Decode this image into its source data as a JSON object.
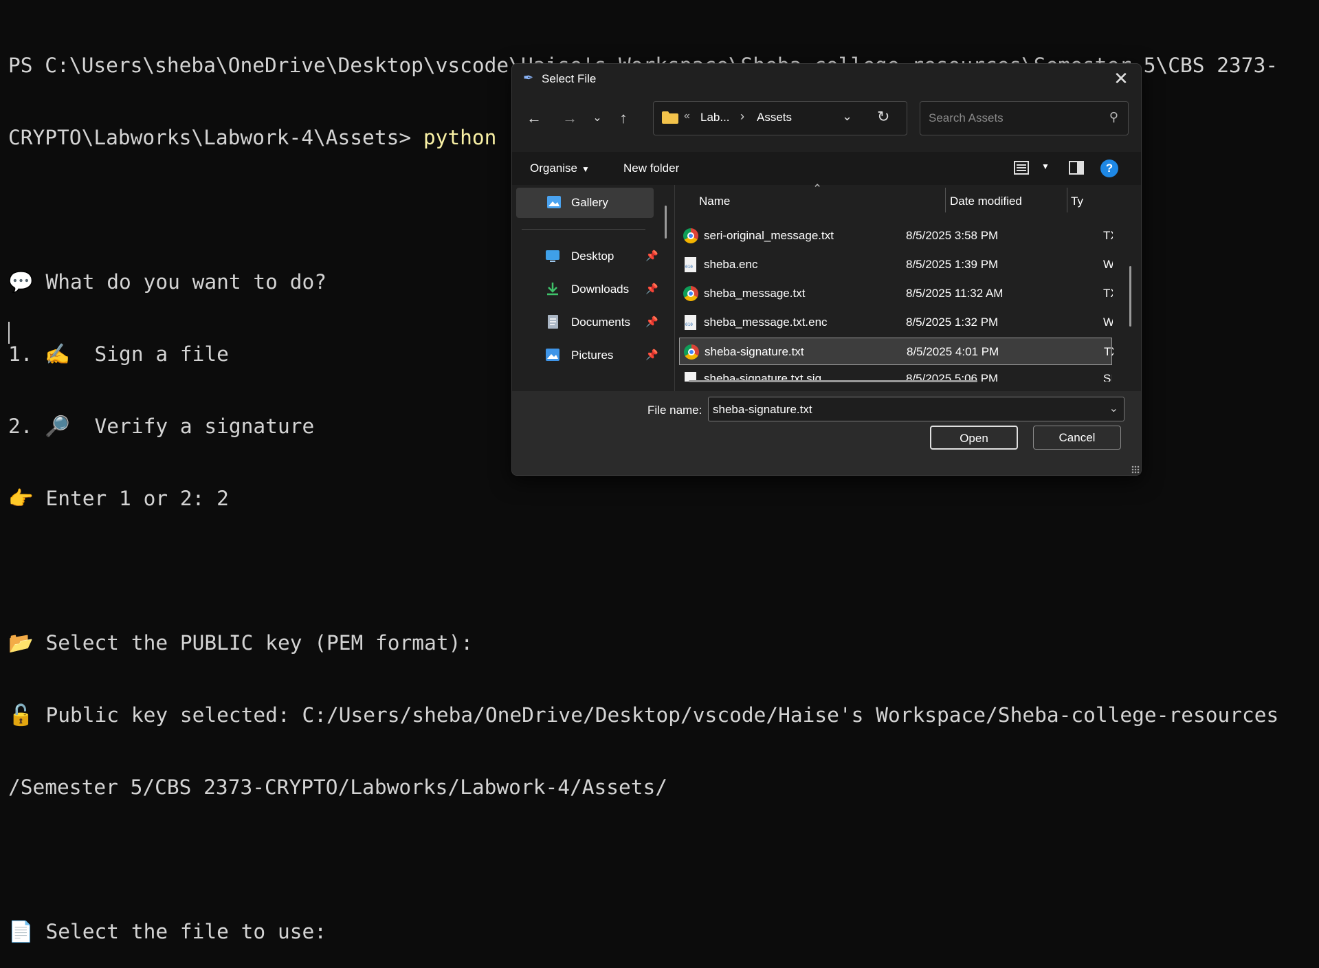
{
  "terminal": {
    "lines": [
      "PS C:\\Users\\sheba\\OneDrive\\Desktop\\vscode\\Haise's Workspace\\Sheba-college-resources\\Semester 5\\CBS 2373-",
      "",
      "",
      "💬 What do you want to do?",
      "1. ✍️  Sign a file",
      "2. 🔎  Verify a signature",
      "👉 Enter 1 or 2: 2",
      "",
      "📂 Select the PUBLIC key (PEM format):",
      "🔓 Public key selected: C:/Users/sheba/OneDrive/Desktop/vscode/Haise's Workspace/Sheba-college-resources",
      "/Semester 5/CBS 2373-CRYPTO/Labworks/Labwork-4/Assets/",
      "",
      "📄 Select the file to use:"
    ],
    "prompt_path_line2": "CRYPTO\\Labworks\\Labwork-4\\Assets> ",
    "command": "python .\\digital_signature.py"
  },
  "dialog": {
    "title": "Select File",
    "address": {
      "part1": "Lab...",
      "part2": "Assets"
    },
    "search_placeholder": "Search Assets",
    "toolbar": {
      "organise": "Organise",
      "new_folder": "New folder"
    },
    "nav": {
      "gallery": "Gallery",
      "desktop": "Desktop",
      "downloads": "Downloads",
      "documents": "Documents",
      "pictures": "Pictures"
    },
    "columns": {
      "name": "Name",
      "date": "Date modified",
      "type": "Ty"
    },
    "files": [
      {
        "name": "seri-original_message.txt",
        "date": "8/5/2025 3:58 PM",
        "type": "TX",
        "icon": "chrome-icon"
      },
      {
        "name": "sheba.enc",
        "date": "8/5/2025 1:39 PM",
        "type": "W",
        "icon": "binary-file-icon"
      },
      {
        "name": "sheba_message.txt",
        "date": "8/5/2025 11:32 AM",
        "type": "TX",
        "icon": "chrome-icon"
      },
      {
        "name": "sheba_message.txt.enc",
        "date": "8/5/2025 1:32 PM",
        "type": "W",
        "icon": "binary-file-icon"
      },
      {
        "name": "sheba-signature.txt",
        "date": "8/5/2025 4:01 PM",
        "type": "TX",
        "icon": "chrome-icon"
      },
      {
        "name": "sheba-signature.txt.sig",
        "date": "8/5/2025 5:06 PM",
        "type": "SI",
        "icon": "file-icon"
      }
    ],
    "file_name_label": "File name:",
    "file_name_value": "sheba-signature.txt",
    "open_label": "Open",
    "cancel_label": "Cancel"
  }
}
